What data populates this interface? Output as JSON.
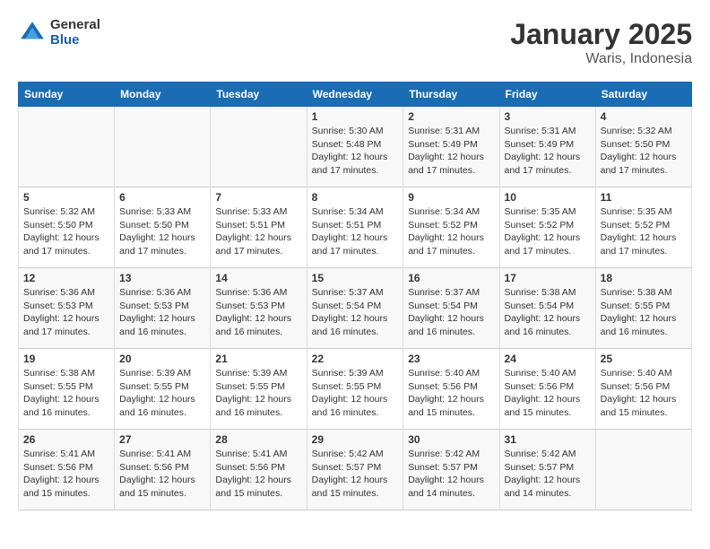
{
  "header": {
    "logo_general": "General",
    "logo_blue": "Blue",
    "title": "January 2025",
    "subtitle": "Waris, Indonesia"
  },
  "weekdays": [
    "Sunday",
    "Monday",
    "Tuesday",
    "Wednesday",
    "Thursday",
    "Friday",
    "Saturday"
  ],
  "weeks": [
    [
      {
        "day": "",
        "info": ""
      },
      {
        "day": "",
        "info": ""
      },
      {
        "day": "",
        "info": ""
      },
      {
        "day": "1",
        "info": "Sunrise: 5:30 AM\nSunset: 5:48 PM\nDaylight: 12 hours\nand 17 minutes."
      },
      {
        "day": "2",
        "info": "Sunrise: 5:31 AM\nSunset: 5:49 PM\nDaylight: 12 hours\nand 17 minutes."
      },
      {
        "day": "3",
        "info": "Sunrise: 5:31 AM\nSunset: 5:49 PM\nDaylight: 12 hours\nand 17 minutes."
      },
      {
        "day": "4",
        "info": "Sunrise: 5:32 AM\nSunset: 5:50 PM\nDaylight: 12 hours\nand 17 minutes."
      }
    ],
    [
      {
        "day": "5",
        "info": "Sunrise: 5:32 AM\nSunset: 5:50 PM\nDaylight: 12 hours\nand 17 minutes."
      },
      {
        "day": "6",
        "info": "Sunrise: 5:33 AM\nSunset: 5:50 PM\nDaylight: 12 hours\nand 17 minutes."
      },
      {
        "day": "7",
        "info": "Sunrise: 5:33 AM\nSunset: 5:51 PM\nDaylight: 12 hours\nand 17 minutes."
      },
      {
        "day": "8",
        "info": "Sunrise: 5:34 AM\nSunset: 5:51 PM\nDaylight: 12 hours\nand 17 minutes."
      },
      {
        "day": "9",
        "info": "Sunrise: 5:34 AM\nSunset: 5:52 PM\nDaylight: 12 hours\nand 17 minutes."
      },
      {
        "day": "10",
        "info": "Sunrise: 5:35 AM\nSunset: 5:52 PM\nDaylight: 12 hours\nand 17 minutes."
      },
      {
        "day": "11",
        "info": "Sunrise: 5:35 AM\nSunset: 5:52 PM\nDaylight: 12 hours\nand 17 minutes."
      }
    ],
    [
      {
        "day": "12",
        "info": "Sunrise: 5:36 AM\nSunset: 5:53 PM\nDaylight: 12 hours\nand 17 minutes."
      },
      {
        "day": "13",
        "info": "Sunrise: 5:36 AM\nSunset: 5:53 PM\nDaylight: 12 hours\nand 16 minutes."
      },
      {
        "day": "14",
        "info": "Sunrise: 5:36 AM\nSunset: 5:53 PM\nDaylight: 12 hours\nand 16 minutes."
      },
      {
        "day": "15",
        "info": "Sunrise: 5:37 AM\nSunset: 5:54 PM\nDaylight: 12 hours\nand 16 minutes."
      },
      {
        "day": "16",
        "info": "Sunrise: 5:37 AM\nSunset: 5:54 PM\nDaylight: 12 hours\nand 16 minutes."
      },
      {
        "day": "17",
        "info": "Sunrise: 5:38 AM\nSunset: 5:54 PM\nDaylight: 12 hours\nand 16 minutes."
      },
      {
        "day": "18",
        "info": "Sunrise: 5:38 AM\nSunset: 5:55 PM\nDaylight: 12 hours\nand 16 minutes."
      }
    ],
    [
      {
        "day": "19",
        "info": "Sunrise: 5:38 AM\nSunset: 5:55 PM\nDaylight: 12 hours\nand 16 minutes."
      },
      {
        "day": "20",
        "info": "Sunrise: 5:39 AM\nSunset: 5:55 PM\nDaylight: 12 hours\nand 16 minutes."
      },
      {
        "day": "21",
        "info": "Sunrise: 5:39 AM\nSunset: 5:55 PM\nDaylight: 12 hours\nand 16 minutes."
      },
      {
        "day": "22",
        "info": "Sunrise: 5:39 AM\nSunset: 5:55 PM\nDaylight: 12 hours\nand 16 minutes."
      },
      {
        "day": "23",
        "info": "Sunrise: 5:40 AM\nSunset: 5:56 PM\nDaylight: 12 hours\nand 15 minutes."
      },
      {
        "day": "24",
        "info": "Sunrise: 5:40 AM\nSunset: 5:56 PM\nDaylight: 12 hours\nand 15 minutes."
      },
      {
        "day": "25",
        "info": "Sunrise: 5:40 AM\nSunset: 5:56 PM\nDaylight: 12 hours\nand 15 minutes."
      }
    ],
    [
      {
        "day": "26",
        "info": "Sunrise: 5:41 AM\nSunset: 5:56 PM\nDaylight: 12 hours\nand 15 minutes."
      },
      {
        "day": "27",
        "info": "Sunrise: 5:41 AM\nSunset: 5:56 PM\nDaylight: 12 hours\nand 15 minutes."
      },
      {
        "day": "28",
        "info": "Sunrise: 5:41 AM\nSunset: 5:56 PM\nDaylight: 12 hours\nand 15 minutes."
      },
      {
        "day": "29",
        "info": "Sunrise: 5:42 AM\nSunset: 5:57 PM\nDaylight: 12 hours\nand 15 minutes."
      },
      {
        "day": "30",
        "info": "Sunrise: 5:42 AM\nSunset: 5:57 PM\nDaylight: 12 hours\nand 14 minutes."
      },
      {
        "day": "31",
        "info": "Sunrise: 5:42 AM\nSunset: 5:57 PM\nDaylight: 12 hours\nand 14 minutes."
      },
      {
        "day": "",
        "info": ""
      }
    ]
  ]
}
